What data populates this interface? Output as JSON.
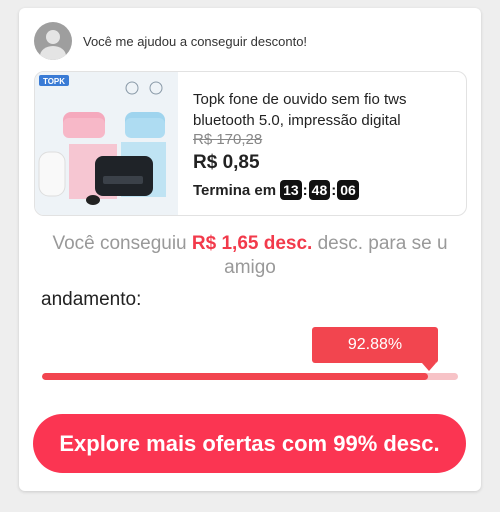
{
  "header": {
    "message": "Você me ajudou a conseguir desconto!"
  },
  "product": {
    "brand": "TOPK",
    "title": "Topk fone de ouvido sem fio tws bluetooth 5.0, impressão digital",
    "old_price": "R$ 170,28",
    "new_price": "R$ 0,85",
    "timer_label": "Termina em",
    "timer": {
      "hours": "13",
      "minutes": "48",
      "seconds": "06"
    }
  },
  "result": {
    "prefix": "Você conseguiu",
    "amount": "R$ 1,65 desc.",
    "suffix": "desc. para se u amigo"
  },
  "progress": {
    "label": "andamento:",
    "percent_text": "92.88%",
    "value": 0.9288
  },
  "cta": {
    "label": "Explore mais ofertas com 99% desc."
  },
  "colors": {
    "accent": "#f2454f",
    "button": "#fb3552",
    "track": "#f7c3c7"
  }
}
